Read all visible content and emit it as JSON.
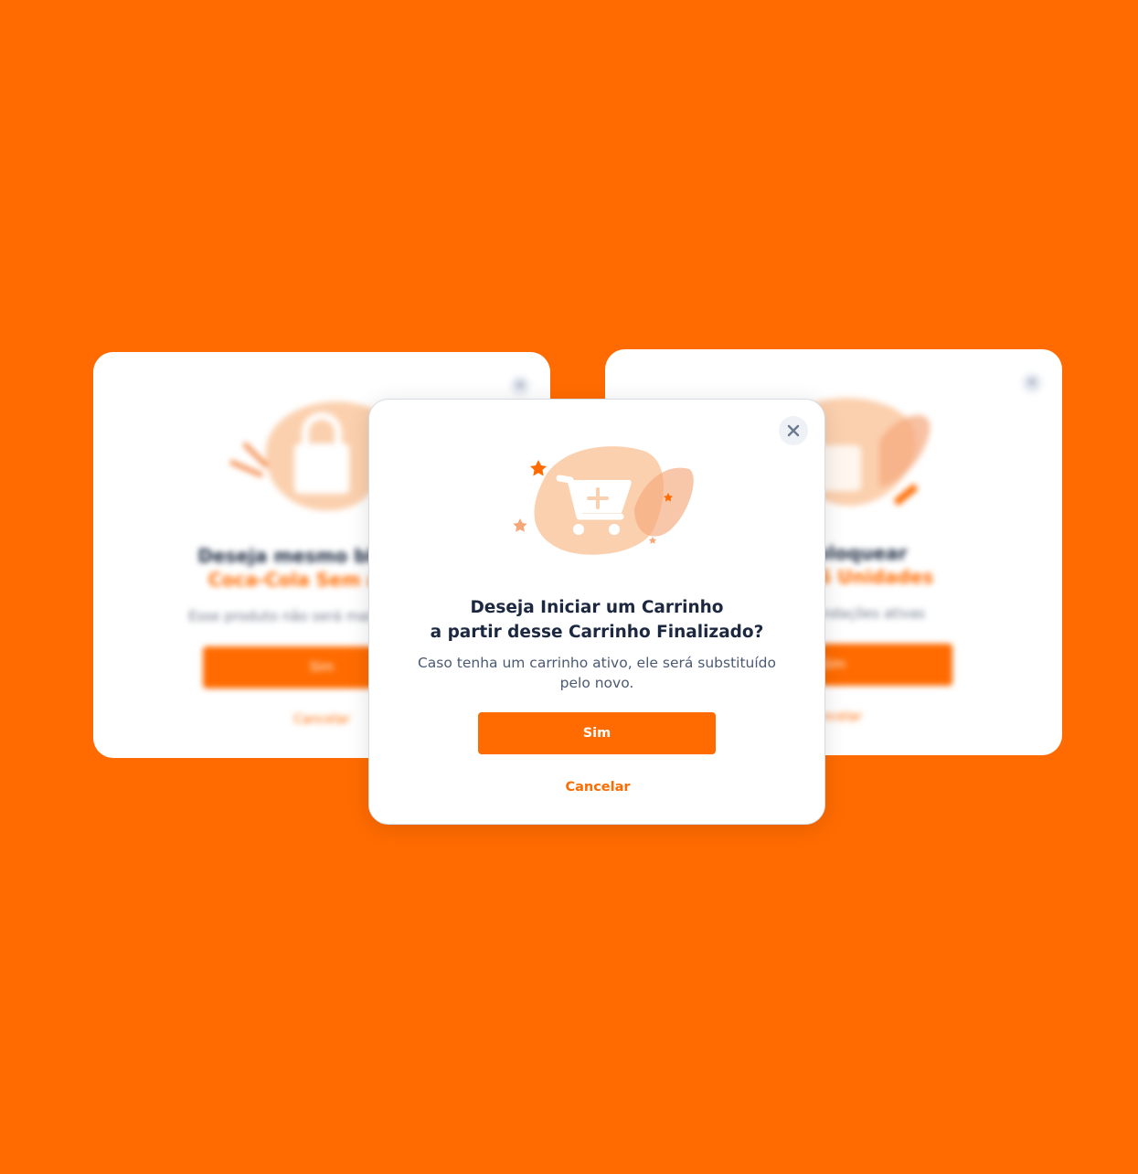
{
  "colors": {
    "background": "#FF6B00",
    "accent": "#FF6B00",
    "title": "#1C2740",
    "description": "#4B5A72",
    "illustration_blob": "#FBD0AE"
  },
  "modal": {
    "title_line1": "Deseja Iniciar um Carrinho",
    "title_line2": "a partir desse Carrinho Finalizado?",
    "description": "Caso tenha um carrinho ativo, ele será substituído pelo novo.",
    "confirm_label": "Sim",
    "cancel_label": "Cancelar",
    "close_icon": "close-icon",
    "illustration_icon": "cart-plus-icon"
  },
  "background_cards": {
    "left": {
      "title": "Deseja mesmo bloquear",
      "highlight": "Coca-Cola Sem açúcar",
      "description": "Esse produto não será mais visível nas",
      "confirm_label": "Sim",
      "cancel_label": "Cancelar",
      "illustration_icon": "lock-icon"
    },
    "right": {
      "title": "o desbloquear",
      "highlight": "2 Litros 6 Unidades",
      "description": "nas recomendações ativas",
      "confirm_label": "Sim",
      "cancel_label": "Cancelar",
      "illustration_icon": "unlock-icon"
    }
  }
}
